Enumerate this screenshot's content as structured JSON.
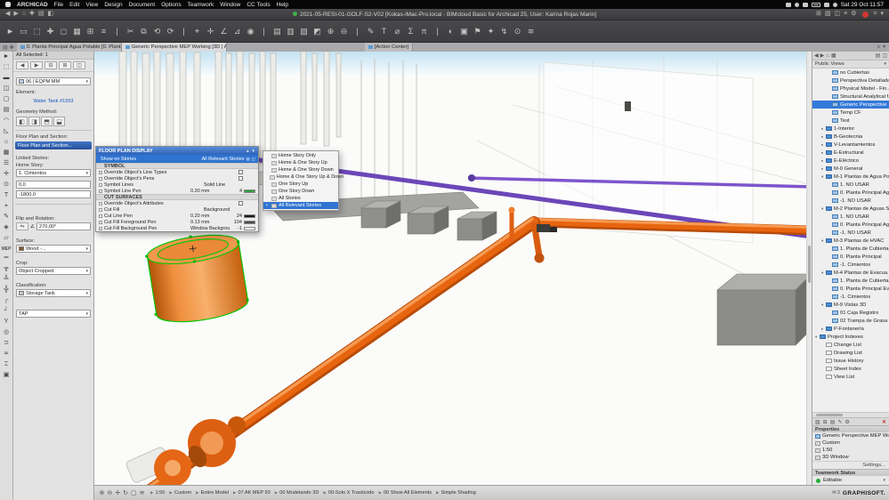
{
  "colors": {
    "accent": "#2f74d0",
    "selection": "#00c800",
    "pipe": "#e06014",
    "editable": "#27ae37"
  },
  "ui": {
    "caret": "▾",
    "chevron": "▶",
    "bullet": "•"
  },
  "menubar": {
    "app": "ARCHICAD",
    "menus": [
      "File",
      "Edit",
      "View",
      "Design",
      "Document",
      "Options",
      "Teamwork",
      "Window",
      "CC Tools",
      "Help"
    ],
    "title": "2021-05-RESI-01-GOLF-S2-V02 [Kokas-iMac-Pro.local - BIMcloud Basic for Archicad 25, User: Karina Rojas Marin]",
    "clock": "Sat 29 Oct 11:57"
  },
  "titlebar": {
    "left_icons": [
      "◀",
      "▶",
      "⌂",
      "✚",
      "▤",
      "◧"
    ],
    "right_icons": [
      "⊞",
      "▧",
      "◫",
      "≡",
      "⚙"
    ],
    "right_icons2": [
      "⌗",
      "▾"
    ]
  },
  "toolbar": {
    "icons": [
      "►",
      "▭",
      "⬚",
      "✚",
      "◻",
      "▦",
      "⊞",
      "≡",
      "|",
      "✂",
      "⧉",
      "⟲",
      "⟳",
      "|",
      "⌖",
      "✛",
      "∠",
      "⊿",
      "◉",
      "|",
      "▤",
      "▥",
      "▧",
      "◩",
      "⊕",
      "⊖",
      "|",
      "✎",
      "Τ",
      "⌀",
      "Σ",
      "π",
      "|",
      "◐",
      "▣",
      "⚑",
      "✦",
      "↯",
      "⊙",
      "≋"
    ]
  },
  "tabbar": {
    "left_icons": [
      "▤",
      "✚"
    ],
    "tabs": [
      {
        "label": "0. Planta Principal Agua Potable [0. Planta Princip..."
      },
      {
        "label": "Generic Perspective MEP Working [3D | All]",
        "active": true
      },
      {
        "label": "[Action Center]",
        "gap": true
      }
    ],
    "right_icons": [
      "≡",
      "▾"
    ]
  },
  "toolbox": {
    "tools": [
      "►",
      "⬚",
      "▬",
      "◫",
      "▢",
      "▤",
      "◠",
      "◺",
      "⌂",
      "▦",
      "☰",
      "✛",
      "⊙",
      "Τ",
      "⌖",
      "✎",
      "◈",
      "▱"
    ],
    "mep_label": "MEP",
    "mep_tools": [
      "═",
      "╦",
      "╩",
      "╬",
      "┌",
      "┘",
      "Y",
      "◎",
      "⊃",
      "≍",
      "⌶",
      "▣"
    ]
  },
  "infobox": {
    "selection": "All Selected: 1",
    "minibar_icons": [
      "◀",
      "▶",
      "⊟",
      "⊞",
      "◫"
    ],
    "layer_value": "06 | EQPM MM",
    "element_label": "Element:",
    "element_value": "Water Tank #1553",
    "geometry_label": "Geometry Method:",
    "geometry_icons": [
      "◧",
      "◨",
      "⬒",
      "⬓"
    ],
    "fps_label": "Floor Plan and Section:",
    "fps_button": "Floor Plan and Section...",
    "linked_label": "Linked Stories:",
    "home_label": "Home Story:",
    "home_value": "1. Cimientos",
    "offset_value": "0,0",
    "bottom_value": "-1800,0",
    "rotation_label": "Flip and Rotation:",
    "flip_icons": [
      "⇋",
      "◁",
      "▷"
    ],
    "angle_icon": "∠",
    "rotation_value": "270,00°",
    "surface_label": "Surface:",
    "surface_value": "Wood -...",
    "surface_swatch": "#8a5a2e",
    "crop_label": "Crop:",
    "crop_value": "Object Cropped",
    "class_label": "Classification:",
    "class_value": "Storage Tank",
    "id_value": "TAP"
  },
  "dialog": {
    "title": "FLOOR PLAN DISPLAY",
    "title_icons": [
      "▲",
      "▼"
    ],
    "show_label": "Show on Stories",
    "show_value": "All Relevant Stories",
    "bluerow_icons": [
      "▤",
      "◫"
    ],
    "symbol_header": "SYMBOL",
    "rows_symbol": [
      {
        "label": "Override Object's Line Types",
        "type": "checkbox"
      },
      {
        "label": "Override Object's Pens",
        "type": "checkbox"
      },
      {
        "label": "Symbol Lines",
        "value": "Solid Line"
      },
      {
        "label": "Symbol Line Pen",
        "value": "0.20 mm",
        "num": "4",
        "swatch": "#2e9e40"
      }
    ],
    "cut_header": "CUT SURFACES",
    "rows_cut": [
      {
        "label": "Override Object's Attributes",
        "type": "checkbox"
      },
      {
        "label": "Cut Fill",
        "value": "Background"
      },
      {
        "label": "Cut Line Pen",
        "value": "0.20 mm",
        "num": "24",
        "swatch": "#1a1a1a"
      },
      {
        "label": "Cut Fill Foreground Pen",
        "value": "0.13 mm",
        "num": "104",
        "swatch": "#4a4a4a"
      },
      {
        "label": "Cut Fill Background Pen",
        "value": "Window Background",
        "num": "-1",
        "swatch": "#ffffff"
      }
    ]
  },
  "menu_popup": {
    "items": [
      {
        "label": "Home Story Only"
      },
      {
        "label": "Home & One Story Up"
      },
      {
        "label": "Home & One Story Down"
      },
      {
        "label": "Home & One Story Up & Down"
      },
      {
        "label": "One Story Up"
      },
      {
        "label": "One Story Down"
      },
      {
        "label": "All Stories"
      },
      {
        "label": "All Relevant Stories",
        "selected": true
      }
    ]
  },
  "navigator": {
    "top_icons_left": [
      "◀",
      "▶",
      "⌂",
      "▦"
    ],
    "top_icons_right": [
      "▤",
      "◫"
    ],
    "header": "Public Views",
    "tree": [
      {
        "label": "no Cubiertas",
        "type": "view",
        "indent": 2
      },
      {
        "label": "Perspectiva Detallada",
        "type": "view",
        "indent": 2
      },
      {
        "label": "Physical Model - Fin...",
        "type": "view",
        "indent": 2
      },
      {
        "label": "Structural Analytical f...",
        "type": "view",
        "indent": 2
      },
      {
        "label": "Generic Perspective",
        "type": "view",
        "indent": 2,
        "selected": true
      },
      {
        "label": "Temp CF",
        "type": "view",
        "indent": 2
      },
      {
        "label": "Test",
        "type": "view",
        "indent": 2
      },
      {
        "label": "1-Interior",
        "type": "folder",
        "indent": 1,
        "arrow": "▸"
      },
      {
        "label": "B-Geotecnia",
        "type": "folder",
        "indent": 1,
        "arrow": "▸"
      },
      {
        "label": "V-Levantamientos",
        "type": "folder",
        "indent": 1,
        "arrow": "▸"
      },
      {
        "label": "E-Estructural",
        "type": "folder",
        "indent": 1,
        "arrow": "▸"
      },
      {
        "label": "E-Eléctrico",
        "type": "folder",
        "indent": 1,
        "arrow": "▸"
      },
      {
        "label": "M-0 General",
        "type": "folder",
        "indent": 1,
        "arrow": "▸"
      },
      {
        "label": "M-1 Plantas de Agua Po...",
        "type": "folder",
        "indent": 1,
        "arrow": "▾"
      },
      {
        "label": "1. NO USAR",
        "type": "view",
        "indent": 2
      },
      {
        "label": "0. Planta Principal Ag...",
        "type": "view",
        "indent": 2
      },
      {
        "label": "-1. NO USAR",
        "type": "view",
        "indent": 2
      },
      {
        "label": "M-2 Plantas de Aguas S...",
        "type": "folder",
        "indent": 1,
        "arrow": "▾"
      },
      {
        "label": "1. NO USAR",
        "type": "view",
        "indent": 2
      },
      {
        "label": "0. Planta Principal Ag...",
        "type": "view",
        "indent": 2
      },
      {
        "label": "-1. NO USAR",
        "type": "view",
        "indent": 2
      },
      {
        "label": "M-3 Plantas de HVAC",
        "type": "folder",
        "indent": 1,
        "arrow": "▾"
      },
      {
        "label": "1. Planta de Cubiertas",
        "type": "view",
        "indent": 2
      },
      {
        "label": "0. Planta Principal",
        "type": "view",
        "indent": 2
      },
      {
        "label": "-1. Cimientos",
        "type": "view",
        "indent": 2
      },
      {
        "label": "M-4 Plantas de Evacua...",
        "type": "folder",
        "indent": 1,
        "arrow": "▾"
      },
      {
        "label": "1. Planta de Cubiertas",
        "type": "view",
        "indent": 2
      },
      {
        "label": "0. Planta Principal Ev...",
        "type": "view",
        "indent": 2
      },
      {
        "label": "-1. Cimientos",
        "type": "view",
        "indent": 2
      },
      {
        "label": "M-9 Vistas 3D",
        "type": "folder",
        "indent": 1,
        "arrow": "▾"
      },
      {
        "label": "01 Caja Registro",
        "type": "view",
        "indent": 2
      },
      {
        "label": "02 Trampa de Grasa",
        "type": "view",
        "indent": 2
      },
      {
        "label": "P-Fontanería",
        "type": "folder",
        "indent": 1,
        "arrow": "▸"
      },
      {
        "label": "Project Indexes",
        "type": "folder",
        "indent": 0,
        "arrow": "▾"
      },
      {
        "label": "Change List",
        "type": "index",
        "indent": 1
      },
      {
        "label": "Drawing List",
        "type": "index",
        "indent": 1
      },
      {
        "label": "Issue History",
        "type": "index",
        "indent": 1
      },
      {
        "label": "Sheet Index",
        "type": "index",
        "indent": 1
      },
      {
        "label": "View List",
        "type": "index",
        "indent": 1
      }
    ],
    "pal_icons": [
      "▧",
      "⊞",
      "▤",
      "✎",
      "⚙"
    ],
    "pal_close": "✕",
    "properties_header": "Properties",
    "view_name": "Generic Perspective MEP Wo",
    "prop_rows": [
      "Custom",
      "1:50",
      "3D Window"
    ],
    "settings_label": "Settings...",
    "teamwork_header": "Teamwork Status",
    "teamwork_status": "Editable"
  },
  "statusbar": {
    "left_icons": [
      "⊕",
      "⊖",
      "✛",
      "↻",
      "▢",
      "≋"
    ],
    "items": [
      "1:50",
      "Custom",
      "Entire Model",
      "07 AK MEP 50",
      "00 Modelando 3D",
      "00-Solo X Traslúcido",
      "00 Show All Elements",
      "Simple Shading"
    ],
    "badge_icon": "✉",
    "badge_count": "3",
    "logo": "GRAPHISOFT."
  }
}
